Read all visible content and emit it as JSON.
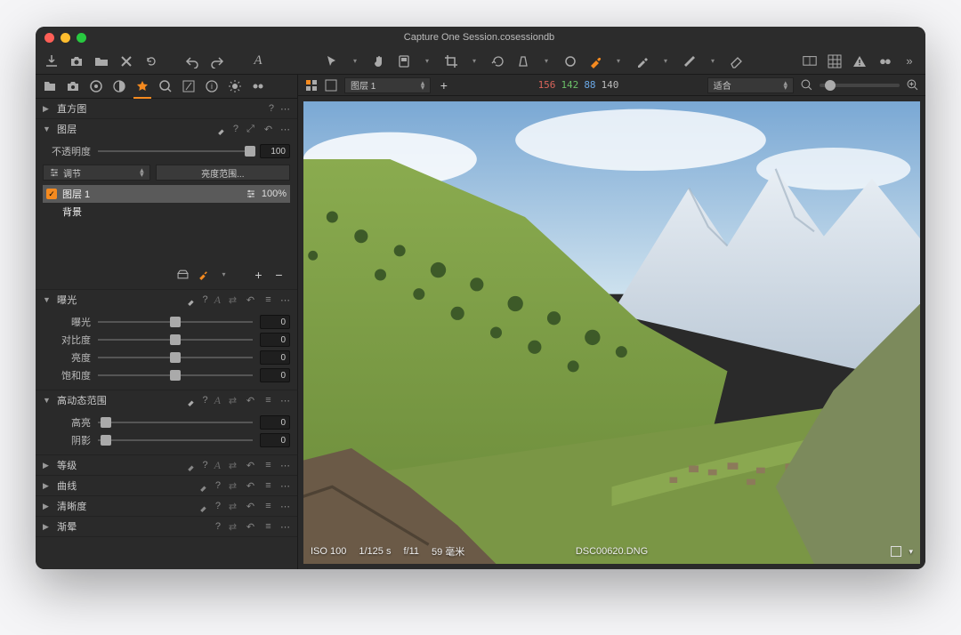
{
  "title": "Capture One Session.cosessiondb",
  "viewer": {
    "layer_selected": "图层 1",
    "rgb": {
      "r": "156",
      "g": "142",
      "b": "88",
      "l": "140"
    },
    "zoom_label": "适合",
    "status": {
      "iso": "ISO 100",
      "shutter": "1/125 s",
      "aperture": "f/11",
      "focal": "59 毫米",
      "file": "DSC00620.DNG"
    }
  },
  "panels": {
    "histogram": {
      "title": "直方图"
    },
    "layers": {
      "title": "图层",
      "opacity_label": "不透明度",
      "opacity_value": "100",
      "adjust_label": "调节",
      "luma_button": "亮度范围...",
      "items": [
        {
          "name": "图层 1",
          "percent": "100%",
          "selected": true,
          "checked": true
        },
        {
          "name": "背景",
          "percent": "",
          "selected": false,
          "checked": false
        }
      ]
    },
    "exposure": {
      "title": "曝光",
      "rows": [
        {
          "label": "曝光",
          "value": "0",
          "pos": 50
        },
        {
          "label": "对比度",
          "value": "0",
          "pos": 50
        },
        {
          "label": "亮度",
          "value": "0",
          "pos": 50
        },
        {
          "label": "饱和度",
          "value": "0",
          "pos": 50
        }
      ]
    },
    "hdr": {
      "title": "高动态范围",
      "rows": [
        {
          "label": "高亮",
          "value": "0",
          "pos": 5
        },
        {
          "label": "阴影",
          "value": "0",
          "pos": 5
        }
      ]
    },
    "collapsed": [
      {
        "title": "等级"
      },
      {
        "title": "曲线"
      },
      {
        "title": "清晰度"
      },
      {
        "title": "渐晕"
      }
    ]
  }
}
